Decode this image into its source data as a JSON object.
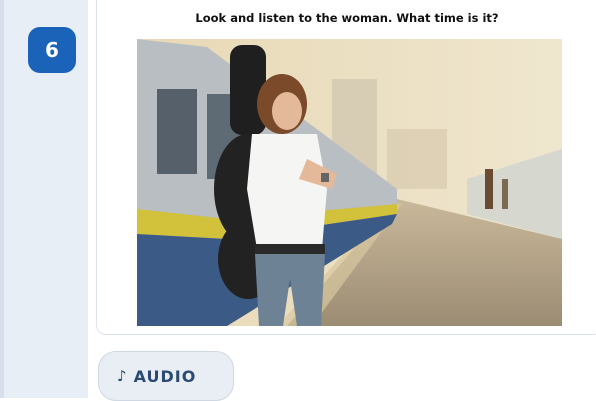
{
  "question": {
    "number": "6",
    "prompt": "Look and listen to the woman. What time is it?"
  },
  "image": {
    "description_icon": "photo-woman-at-train-station"
  },
  "audio": {
    "icon": "♪",
    "label": "AUDIO"
  },
  "colors": {
    "badge": "#1a63b9",
    "strip": "#e8eef5",
    "audio_text": "#2a4b73"
  }
}
